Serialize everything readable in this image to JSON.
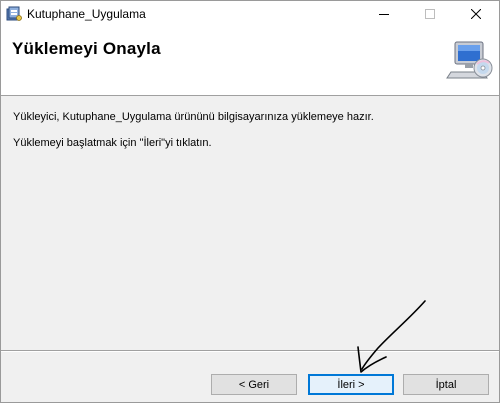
{
  "window": {
    "title": "Kutuphane_Uygulama",
    "icon": "installer-icon",
    "controls": {
      "minimize": "minimize-icon",
      "maximize": "maximize-icon",
      "close": "close-icon"
    }
  },
  "header": {
    "title": "Yüklemeyi Onayla",
    "icon": "computer-cd-icon"
  },
  "content": {
    "line1": "Yükleyici, Kutuphane_Uygulama ürününü bilgisayarınıza yüklemeye hazır.",
    "line2": "Yüklemeyi başlatmak için \"İleri\"yi tıklatın."
  },
  "buttons": {
    "back": "< Geri",
    "next": "İleri >",
    "cancel": "İptal"
  },
  "colors": {
    "accent": "#0078d7",
    "window_bg": "#f0f0f0",
    "header_bg": "#ffffff"
  }
}
